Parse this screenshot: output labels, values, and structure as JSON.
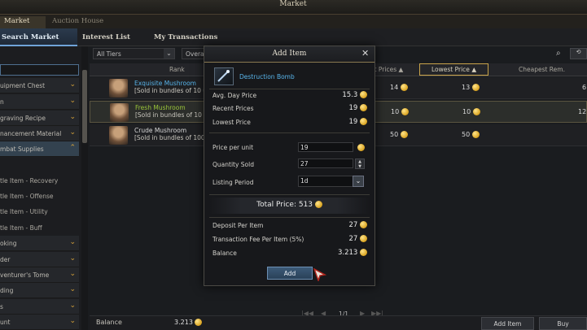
{
  "window_title": "Market",
  "main_tabs": {
    "market": "Market",
    "auction": "Auction House"
  },
  "sub_tabs": {
    "search": "Search Market",
    "interest": "Interest List",
    "transactions": "My Transactions"
  },
  "sidebar": {
    "categories": [
      {
        "label": "uipment Chest"
      },
      {
        "label": "n"
      },
      {
        "label": "graving Recipe"
      },
      {
        "label": "nancement Material"
      },
      {
        "label": "mbat Supplies"
      }
    ],
    "subs": [
      {
        "label": "tle Item - Recovery"
      },
      {
        "label": "tle Item - Offense"
      },
      {
        "label": "tle Item - Utility"
      },
      {
        "label": "tle Item - Buff"
      }
    ],
    "lower": [
      {
        "label": "oking"
      },
      {
        "label": "der"
      },
      {
        "label": "venturer's Tome"
      },
      {
        "label": "ding"
      },
      {
        "label": "s"
      },
      {
        "label": "unt"
      }
    ]
  },
  "filters": {
    "tiers": "All Tiers",
    "overall": "Overall"
  },
  "table": {
    "headers": {
      "rank": "Rank",
      "avg": "at Prices",
      "lowest": "Lowest Price",
      "cheapest": "Cheapest Rem."
    },
    "rows": [
      {
        "name": "Exquisite Mushroom",
        "name_color": "#58b4ea",
        "sub": "[Sold in bundles of 10 u",
        "avg": "14",
        "lowest": "13",
        "cheapest": "6"
      },
      {
        "name": "Fresh Mushroom",
        "name_color": "#9ac53a",
        "sub": "[Sold in bundles of 10 u",
        "avg": "10",
        "lowest": "10",
        "cheapest": "12"
      },
      {
        "name": "Crude Mushroom",
        "name_color": "#d8d8d8",
        "sub": "[Sold in bundles of 100",
        "avg": "50",
        "lowest": "50",
        "cheapest": ""
      }
    ]
  },
  "pagination": {
    "page": "1/1"
  },
  "bottom": {
    "balance_label": "Balance",
    "balance_value": "3.213",
    "add_item": "Add Item",
    "buy": "Buy"
  },
  "modal": {
    "title": "Add Item",
    "item_name": "Destruction Bomb",
    "avg_day_label": "Avg. Day Price",
    "avg_day_value": "15.3",
    "recent_label": "Recent Prices",
    "recent_value": "19",
    "lowest_label": "Lowest Price",
    "lowest_value": "19",
    "ppu_label": "Price per unit",
    "ppu_value": "19",
    "qty_label": "Quantity Sold",
    "qty_value": "27",
    "period_label": "Listing Period",
    "period_value": "1d",
    "total_label": "Total Price: 513",
    "deposit_label": "Deposit Per Item",
    "deposit_value": "27",
    "fee_label": "Transaction Fee Per Item (5%)",
    "fee_value": "27",
    "balance_label": "Balance",
    "balance_value": "3.213",
    "add_button": "Add"
  },
  "colors": {
    "accent_blue": "#58b4ea",
    "gold": "#d9a21f",
    "selected_border": "#5a5440"
  },
  "icons": [
    "close-icon",
    "coin-icon",
    "chevron-down-icon",
    "search-icon",
    "destruction-bomb-icon",
    "mushroom-icon",
    "cursor-icon"
  ]
}
